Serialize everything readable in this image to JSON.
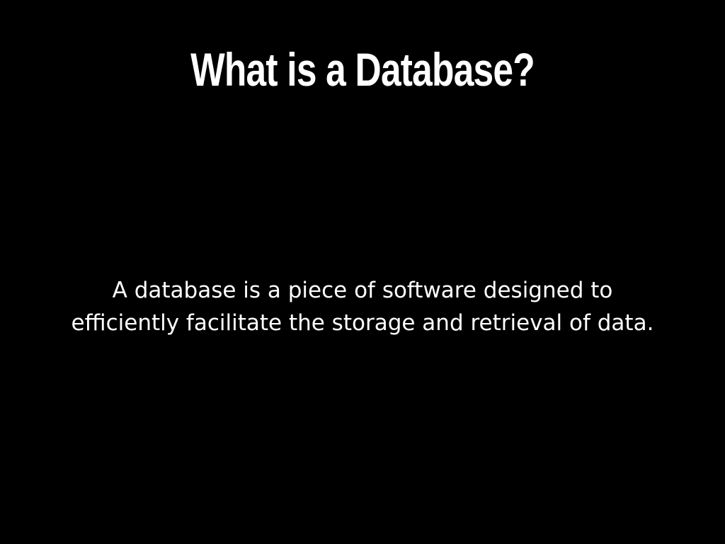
{
  "slide": {
    "title": "What is a Database?",
    "body": "A database is a piece of software designed to efficiently facilitate the storage and retrieval of data."
  },
  "colors": {
    "background": "#000000",
    "text": "#ffffff"
  }
}
